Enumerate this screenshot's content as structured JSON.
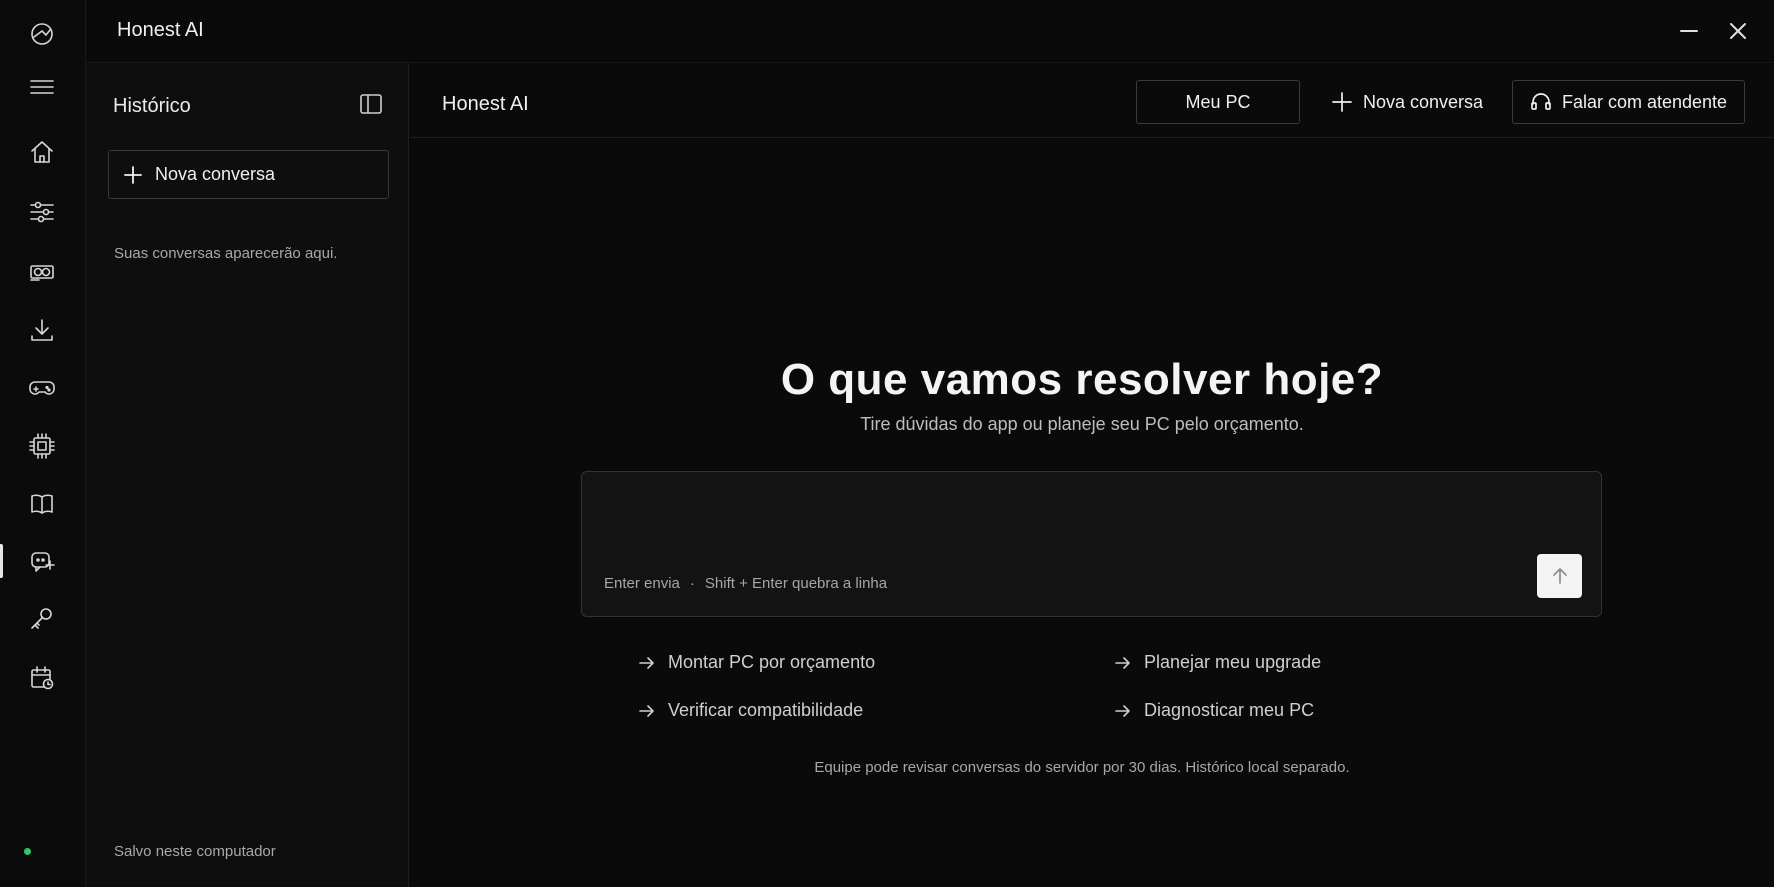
{
  "app": {
    "title": "Honest AI"
  },
  "window_controls": {
    "minimize_icon": "minimize-icon",
    "close_icon": "close-icon"
  },
  "rail": {
    "items": [
      {
        "icon": "logo-icon"
      },
      {
        "icon": "menu-icon"
      },
      {
        "icon": "home-icon"
      },
      {
        "icon": "sliders-icon"
      },
      {
        "icon": "gpu-icon"
      },
      {
        "icon": "download-icon"
      },
      {
        "icon": "gamepad-icon"
      },
      {
        "icon": "chip-icon"
      },
      {
        "icon": "book-icon"
      },
      {
        "icon": "ai-chat-icon",
        "active": true
      },
      {
        "icon": "key-icon"
      },
      {
        "icon": "calendar-icon"
      }
    ],
    "status_color": "#35c46a"
  },
  "sidebar": {
    "title": "Histórico",
    "new_chat_label": "Nova conversa",
    "empty_text": "Suas conversas aparecerão aqui.",
    "footer": "Salvo neste computador"
  },
  "header": {
    "title": "Honest AI",
    "my_pc_label": "Meu PC",
    "new_chat_label": "Nova conversa",
    "agent_label": "Falar com atendente"
  },
  "hero": {
    "title": "O que vamos resolver hoje?",
    "subtitle": "Tire dúvidas do app ou planeje seu PC pelo orçamento."
  },
  "composer": {
    "placeholder": "",
    "hint_send": "Enter envia",
    "hint_sep": "·",
    "hint_newline": "Shift + Enter quebra a linha"
  },
  "suggestions": [
    "Montar PC por orçamento",
    "Planejar meu upgrade",
    "Verificar compatibilidade",
    "Diagnosticar meu PC"
  ],
  "disclaimer": "Equipe pode revisar conversas do servidor por 30 dias. Histórico local separado."
}
